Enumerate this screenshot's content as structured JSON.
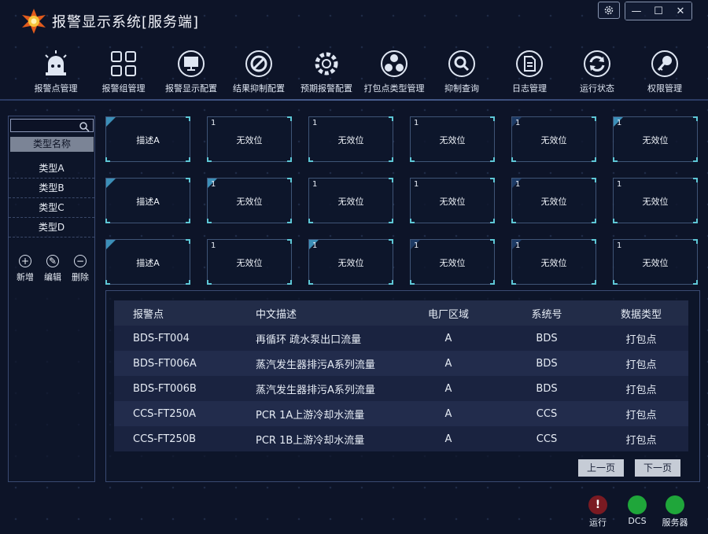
{
  "app": {
    "title": "报警显示系统[服务端]"
  },
  "window": {
    "settings_icon": "gear-icon",
    "minimize": "—",
    "maximize": "☐",
    "close": "✕"
  },
  "toolbar": [
    {
      "label": "报警点管理",
      "icon": "siren-icon"
    },
    {
      "label": "报警组管理",
      "icon": "grid-icon"
    },
    {
      "label": "报警显示配置",
      "icon": "monitor-icon"
    },
    {
      "label": "结果抑制配置",
      "icon": "prohibit-icon"
    },
    {
      "label": "预期报警配置",
      "icon": "gear-icon"
    },
    {
      "label": "打包点类型管理",
      "icon": "cluster-icon"
    },
    {
      "label": "抑制查询",
      "icon": "search-icon"
    },
    {
      "label": "日志管理",
      "icon": "document-icon"
    },
    {
      "label": "运行状态",
      "icon": "refresh-icon"
    },
    {
      "label": "权限管理",
      "icon": "key-icon"
    }
  ],
  "sidebar": {
    "search_placeholder": "",
    "header": "类型名称",
    "items": [
      "类型A",
      "类型B",
      "类型C",
      "类型D"
    ],
    "actions": [
      {
        "label": "新增",
        "symbol": "+"
      },
      {
        "label": "编辑",
        "symbol": "✎"
      },
      {
        "label": "删除",
        "symbol": "−"
      }
    ]
  },
  "grid": {
    "cells": [
      {
        "num": "",
        "text": "描述A",
        "corner": "light"
      },
      {
        "num": "1",
        "text": "无效位",
        "corner": "none"
      },
      {
        "num": "1",
        "text": "无效位",
        "corner": "none"
      },
      {
        "num": "1",
        "text": "无效位",
        "corner": "none"
      },
      {
        "num": "1",
        "text": "无效位",
        "corner": "dark"
      },
      {
        "num": "1",
        "text": "无效位",
        "corner": "light"
      },
      {
        "num": "",
        "text": "描述A",
        "corner": "light"
      },
      {
        "num": "1",
        "text": "无效位",
        "corner": "light"
      },
      {
        "num": "1",
        "text": "无效位",
        "corner": "none"
      },
      {
        "num": "1",
        "text": "无效位",
        "corner": "none"
      },
      {
        "num": "1",
        "text": "无效位",
        "corner": "dark"
      },
      {
        "num": "1",
        "text": "无效位",
        "corner": "none"
      },
      {
        "num": "",
        "text": "描述A",
        "corner": "light"
      },
      {
        "num": "1",
        "text": "无效位",
        "corner": "none"
      },
      {
        "num": "1",
        "text": "无效位",
        "corner": "light"
      },
      {
        "num": "1",
        "text": "无效位",
        "corner": "dark"
      },
      {
        "num": "1",
        "text": "无效位",
        "corner": "dark"
      },
      {
        "num": "1",
        "text": "无效位",
        "corner": "none"
      }
    ]
  },
  "table": {
    "headers": [
      "报警点",
      "中文描述",
      "电厂区域",
      "系统号",
      "数据类型"
    ],
    "rows": [
      [
        "BDS-FT004",
        "再循环 疏水泵出口流量",
        "A",
        "BDS",
        "打包点"
      ],
      [
        "BDS-FT006A",
        "蒸汽发生器排污A系列流量",
        "A",
        "BDS",
        "打包点"
      ],
      [
        "BDS-FT006B",
        "蒸汽发生器排污A系列流量",
        "A",
        "BDS",
        "打包点"
      ],
      [
        "CCS-FT250A",
        "PCR 1A上游冷却水流量",
        "A",
        "CCS",
        "打包点"
      ],
      [
        "CCS-FT250B",
        "PCR 1B上游冷却水流量",
        "A",
        "CCS",
        "打包点"
      ]
    ],
    "prev_label": "上一页",
    "next_label": "下一页"
  },
  "status": [
    {
      "label": "运行",
      "color": "#7a1a22",
      "symbol": "!"
    },
    {
      "label": "DCS",
      "color": "#1fa63a",
      "symbol": ""
    },
    {
      "label": "服务器",
      "color": "#1fa63a",
      "symbol": ""
    }
  ]
}
